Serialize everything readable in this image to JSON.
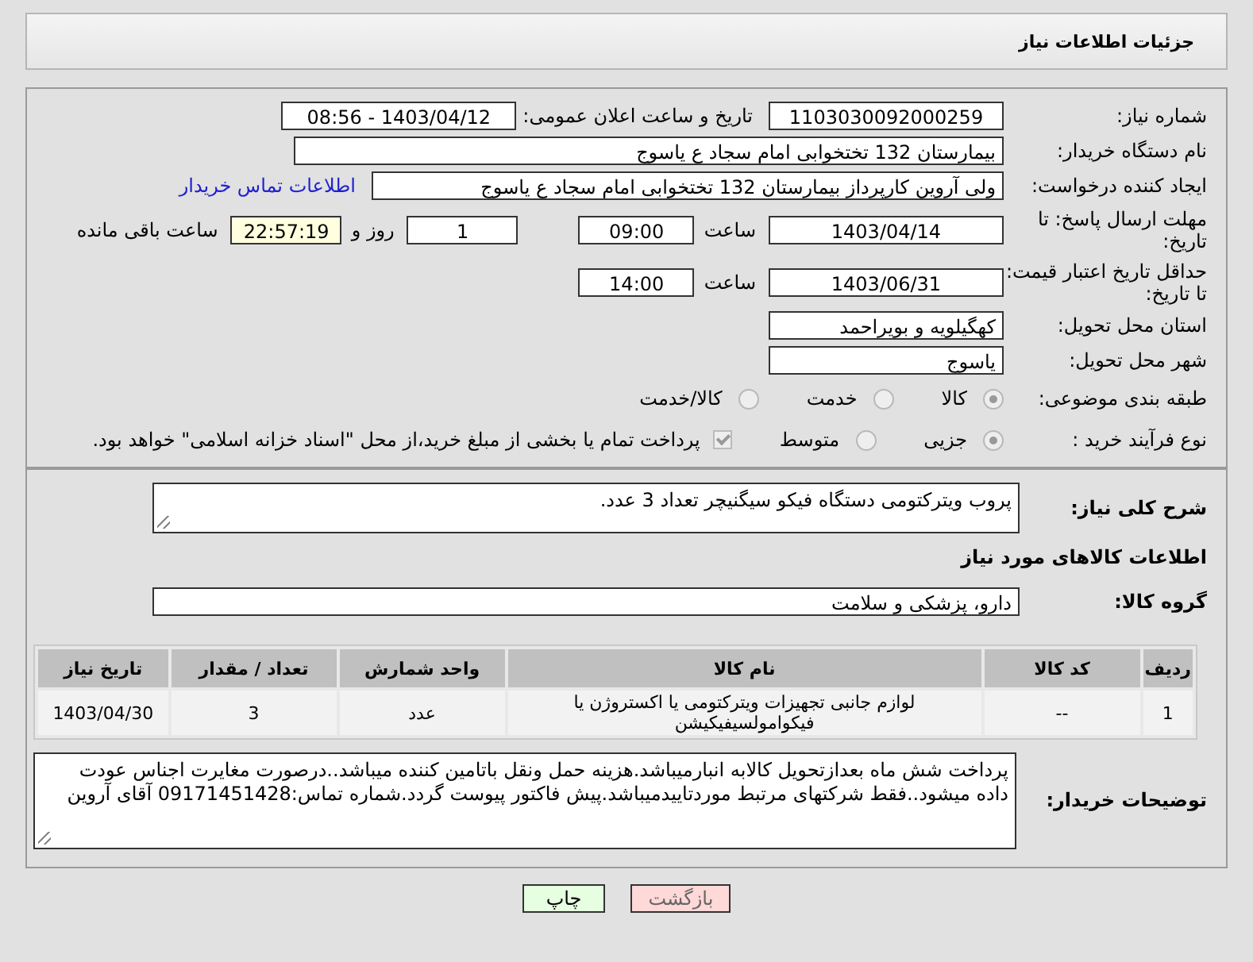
{
  "header": {
    "title": "جزئیات اطلاعات نیاز"
  },
  "need_number": {
    "label": "شماره نیاز:",
    "value": "1103030092000259"
  },
  "announce": {
    "label": "تاریخ و ساعت اعلان عمومی:",
    "value": "1403/04/12 - 08:56"
  },
  "buyer_org": {
    "label": "نام دستگاه خریدار:",
    "value": "بیمارستان 132 تختخوابی امام سجاد  ع  یاسوج"
  },
  "creator": {
    "label": "ایجاد کننده درخواست:",
    "value": "ولی آروین کارپرداز بیمارستان 132 تختخوابی امام سجاد  ع  یاسوج",
    "link": "اطلاعات تماس خریدار"
  },
  "reply_deadline": {
    "label": "مهلت ارسال پاسخ: تا تاریخ:",
    "date": "1403/04/14",
    "time_label": "ساعت",
    "time": "09:00",
    "days": "1",
    "days_label": "روز و",
    "remaining": "22:57:19",
    "remaining_label": "ساعت باقی مانده"
  },
  "price_validity": {
    "label": "حداقل تاریخ اعتبار قیمت: تا تاریخ:",
    "date": "1403/06/31",
    "time_label": "ساعت",
    "time": "14:00"
  },
  "province": {
    "label": "استان محل تحویل:",
    "value": "کهگیلویه و بویراحمد"
  },
  "city": {
    "label": "شهر محل تحویل:",
    "value": "یاسوج"
  },
  "category": {
    "label": "طبقه بندی موضوعی:",
    "options": [
      {
        "label": "کالا",
        "selected": true
      },
      {
        "label": "خدمت",
        "selected": false
      },
      {
        "label": "کالا/خدمت",
        "selected": false
      }
    ]
  },
  "purchase_type": {
    "label": "نوع فرآیند خرید :",
    "options": [
      {
        "label": "جزیی",
        "selected": true
      },
      {
        "label": "متوسط",
        "selected": false
      }
    ],
    "treasury": {
      "checked": true,
      "text": "پرداخت تمام یا بخشی از مبلغ خرید،از محل \"اسناد خزانه اسلامی\" خواهد بود."
    }
  },
  "description": {
    "label": "شرح کلی نیاز:",
    "value": "پروب ویترکتومی دستگاه فیکو سیگنیچر تعداد 3 عدد."
  },
  "goods_heading": "اطلاعات کالاهای مورد نیاز",
  "goods_group": {
    "label": "گروه کالا:",
    "value": "دارو، پزشکی و سلامت"
  },
  "table": {
    "columns": [
      "ردیف",
      "کد کالا",
      "نام کالا",
      "واحد شمارش",
      "تعداد / مقدار",
      "تاریخ نیاز"
    ],
    "rows": [
      [
        "1",
        "--",
        "لوازم جانبی تجهیزات ویترکتومی یا اکستروژن یا فیکوامولسیفیکیشن",
        "عدد",
        "3",
        "1403/04/30"
      ]
    ]
  },
  "buyer_notes": {
    "label": "توضیحات خریدار:",
    "value": "پرداخت شش ماه بعدازتحویل کالابه انبارمیباشد.هزینه حمل ونقل باتامین کننده میباشد..درصورت مغایرت اجناس عودت داده میشود..فقط شرکتهای مرتبط موردتاییدمیباشد.پیش فاکتور پیوست گردد.شماره تماس:09171451428 آقای آروین"
  },
  "buttons": [
    {
      "label": "بازگشت",
      "kind": "back"
    },
    {
      "label": "چاپ",
      "kind": "print"
    }
  ]
}
